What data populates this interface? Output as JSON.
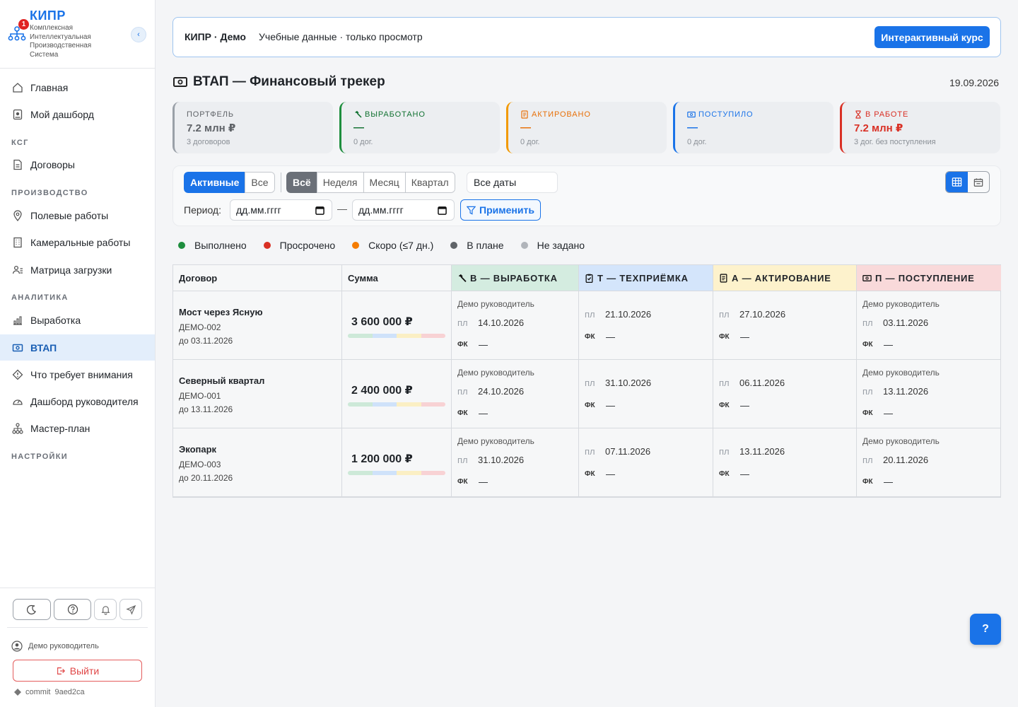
{
  "brand": {
    "name": "КИПР",
    "subtitle": "Комплексная Интеллектуальная Производственная Система",
    "badge": "1"
  },
  "nav": {
    "items": [
      {
        "label": "Главная",
        "icon": "home-icon"
      },
      {
        "label": "Мой дашборд",
        "icon": "dashboard-icon"
      },
      {
        "label": "Договоры",
        "icon": "document-icon"
      },
      {
        "label": "Полевые работы",
        "icon": "location-pin-icon"
      },
      {
        "label": "Камеральные работы",
        "icon": "building-icon"
      },
      {
        "label": "Матрица загрузки",
        "icon": "users-matrix-icon"
      },
      {
        "label": "Выработка",
        "icon": "bar-chart-icon"
      },
      {
        "label": "ВТАП",
        "icon": "money-icon",
        "active": true
      },
      {
        "label": "Что требует внимания",
        "icon": "warning-diamond-icon"
      },
      {
        "label": "Дашборд руководителя",
        "icon": "speedometer-icon"
      },
      {
        "label": "Мастер-план",
        "icon": "hierarchy-icon"
      }
    ],
    "sections": [
      "КСГ",
      "ПРОИЗВОДСТВО",
      "АНАЛИТИКА",
      "НАСТРОЙКИ"
    ]
  },
  "footer": {
    "user": "Демо руководитель",
    "logout": "Выйти",
    "commit_label": "commit",
    "commit_hash": "9aed2ca"
  },
  "banner": {
    "title": "КИПР · Демо",
    "text": "Учебные данные · только просмотр",
    "button": "Интерактивный курс"
  },
  "page": {
    "title": "ВТАП — Финансовый трекер",
    "date": "19.09.2026"
  },
  "kpis": [
    {
      "label": "ПОРТФЕЛЬ",
      "value": "7.2 млн ₽",
      "sub": "3 договоров",
      "color": "#5f6368",
      "accent": "#9aa0a8",
      "icon": ""
    },
    {
      "label": "ВЫРАБОТАНО",
      "value": "—",
      "sub": "0 дог.",
      "color": "#137333",
      "accent": "#1e8e3e",
      "icon": "hammer-icon"
    },
    {
      "label": "АКТИРОВАНО",
      "value": "—",
      "sub": "0 дог.",
      "color": "#e8710a",
      "accent": "#f29900",
      "icon": "receipt-icon"
    },
    {
      "label": "ПОСТУПИЛО",
      "value": "—",
      "sub": "0 дог.",
      "color": "#1a73e8",
      "accent": "#1a73e8",
      "icon": "cash-icon"
    },
    {
      "label": "В РАБОТЕ",
      "value": "7.2 млн ₽",
      "sub": "3 дог. без поступления",
      "color": "#d93025",
      "accent": "#d93025",
      "icon": "hourglass-icon"
    }
  ],
  "filters": {
    "status": [
      "Активные",
      "Все"
    ],
    "range": [
      "Всё",
      "Неделя",
      "Месяц",
      "Квартал"
    ],
    "date_select": "Все даты",
    "period_label": "Период:",
    "date_from_placeholder": "дд.мм.гггг",
    "date_to_placeholder": "дд.мм.гггг",
    "dash": "—",
    "apply": "Применить"
  },
  "legend": [
    {
      "label": "Выполнено",
      "color": "#1e8e3e"
    },
    {
      "label": "Просрочено",
      "color": "#d93025"
    },
    {
      "label": "Скоро (≤7 дн.)",
      "color": "#f57c00"
    },
    {
      "label": "В плане",
      "color": "#5f6368"
    },
    {
      "label": "Не задано",
      "color": "#b0b4ba"
    }
  ],
  "table": {
    "headers": {
      "contract": "Договор",
      "sum": "Сумма",
      "v": "В — ВЫРАБОТКА",
      "t": "Т — ТЕХПРИЁМКА",
      "a": "А — АКТИРОВАНИЕ",
      "p": "П — ПОСТУПЛЕНИЕ"
    },
    "pl_label": "пл",
    "fk_label": "ФК",
    "empty": "—",
    "rows": [
      {
        "name": "Мост через Ясную",
        "code": "ДЕМО-002",
        "due": "до 03.11.2026",
        "sum": "3 600 000 ₽",
        "v": {
          "resp": "Демо руководитель",
          "pl": "14.10.2026"
        },
        "t": {
          "pl": "21.10.2026"
        },
        "a": {
          "pl": "27.10.2026"
        },
        "p": {
          "resp": "Демо руководитель",
          "pl": "03.11.2026"
        }
      },
      {
        "name": "Северный квартал",
        "code": "ДЕМО-001",
        "due": "до 13.11.2026",
        "sum": "2 400 000 ₽",
        "v": {
          "resp": "Демо руководитель",
          "pl": "24.10.2026"
        },
        "t": {
          "pl": "31.10.2026"
        },
        "a": {
          "pl": "06.11.2026"
        },
        "p": {
          "resp": "Демо руководитель",
          "pl": "13.11.2026"
        }
      },
      {
        "name": "Экопарк",
        "code": "ДЕМО-003",
        "due": "до 20.11.2026",
        "sum": "1 200 000 ₽",
        "v": {
          "resp": "Демо руководитель",
          "pl": "31.10.2026"
        },
        "t": {
          "pl": "07.11.2026"
        },
        "a": {
          "pl": "13.11.2026"
        },
        "p": {
          "resp": "Демо руководитель",
          "pl": "20.11.2026"
        }
      }
    ]
  },
  "help_fab": "?"
}
